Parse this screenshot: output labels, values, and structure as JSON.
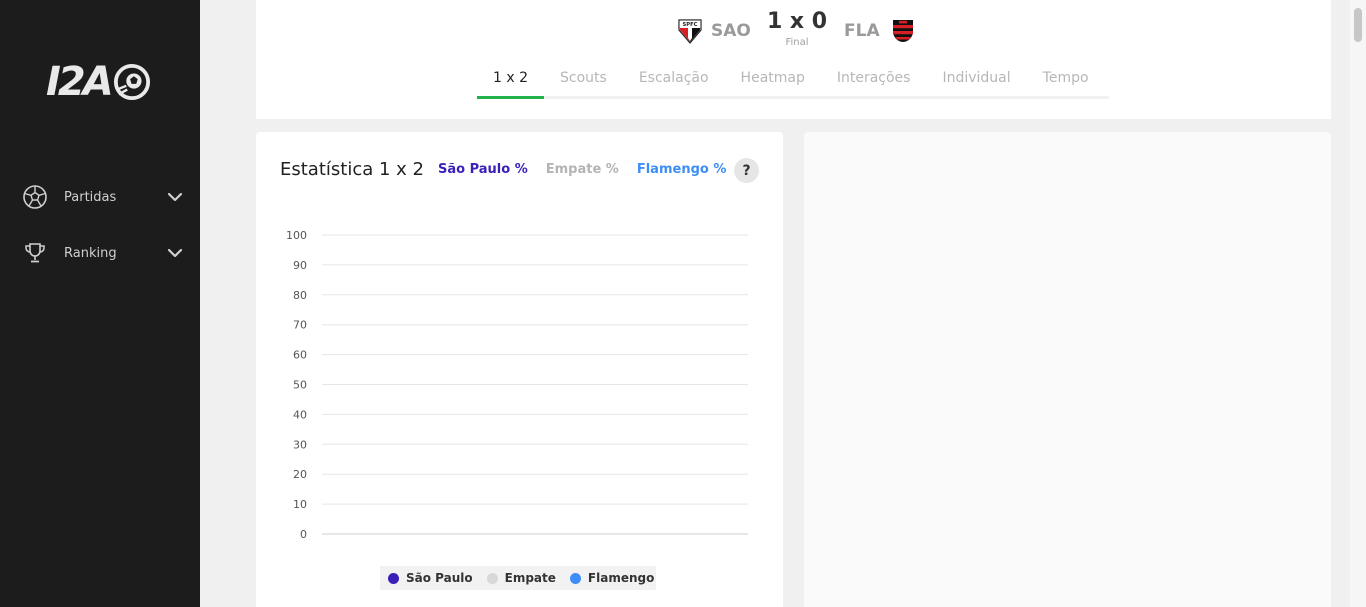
{
  "brand": {
    "logo_text": "I2A"
  },
  "sidebar": {
    "items": [
      {
        "label": "Partidas",
        "icon": "soccer-ball-icon"
      },
      {
        "label": "Ranking",
        "icon": "trophy-icon"
      }
    ]
  },
  "match": {
    "home": {
      "abbr": "SAO",
      "crest_text": "SPFC"
    },
    "away": {
      "abbr": "FLA"
    },
    "score": "1 x 0",
    "status": "Final"
  },
  "tabs": [
    {
      "label": "1 x 2",
      "active": true
    },
    {
      "label": "Scouts"
    },
    {
      "label": "Escalação"
    },
    {
      "label": "Heatmap"
    },
    {
      "label": "Interações"
    },
    {
      "label": "Individual"
    },
    {
      "label": "Tempo"
    }
  ],
  "stats": {
    "title": "Estatística 1 x 2",
    "filters": [
      {
        "label": "São Paulo %",
        "color": "#3b1fb8"
      },
      {
        "label": "Empate %",
        "color": "#b4b4b4"
      },
      {
        "label": "Flamengo %",
        "color": "#3e8ef7"
      }
    ],
    "help_label": "?"
  },
  "colors": {
    "accent_green": "#22b24c",
    "sao_paulo": "#3b1fb8",
    "empate": "#d8d8d8",
    "flamengo": "#3e8ef7"
  },
  "chart_data": {
    "type": "line",
    "title": "Estatística 1 x 2",
    "y_ticks": [
      0,
      10,
      20,
      30,
      40,
      50,
      60,
      70,
      80,
      90,
      100
    ],
    "ylim": [
      0,
      100
    ],
    "grid": true,
    "series": [
      {
        "name": "São Paulo",
        "color": "#3b1fb8",
        "values": []
      },
      {
        "name": "Empate",
        "color": "#d8d8d8",
        "values": []
      },
      {
        "name": "Flamengo",
        "color": "#3e8ef7",
        "values": []
      }
    ],
    "legend": "bottom"
  }
}
